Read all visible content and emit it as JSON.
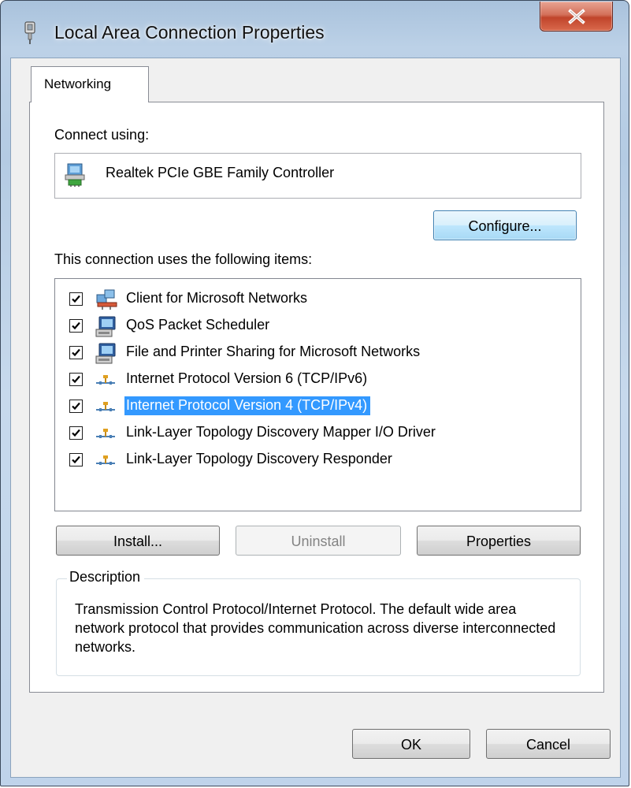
{
  "window": {
    "title": "Local Area Connection Properties",
    "close_label": "X"
  },
  "tabs": [
    {
      "label": "Networking",
      "selected": true
    }
  ],
  "connect_using": {
    "label": "Connect using:",
    "adapter": "Realtek PCIe GBE Family Controller",
    "configure_button": "Configure..."
  },
  "items_section": {
    "label": "This connection uses the following items:",
    "items": [
      {
        "label": "Client for Microsoft Networks",
        "checked": true,
        "icon": "client-network-icon",
        "selected": false
      },
      {
        "label": "QoS Packet Scheduler",
        "checked": true,
        "icon": "service-icon",
        "selected": false
      },
      {
        "label": "File and Printer Sharing for Microsoft Networks",
        "checked": true,
        "icon": "service-icon",
        "selected": false
      },
      {
        "label": "Internet Protocol Version 6 (TCP/IPv6)",
        "checked": true,
        "icon": "protocol-icon",
        "selected": false
      },
      {
        "label": "Internet Protocol Version 4 (TCP/IPv4)",
        "checked": true,
        "icon": "protocol-icon",
        "selected": true
      },
      {
        "label": "Link-Layer Topology Discovery Mapper I/O Driver",
        "checked": true,
        "icon": "protocol-icon",
        "selected": false
      },
      {
        "label": "Link-Layer Topology Discovery Responder",
        "checked": true,
        "icon": "protocol-icon",
        "selected": false
      }
    ]
  },
  "actions": {
    "install": "Install...",
    "uninstall": "Uninstall",
    "properties": "Properties"
  },
  "description": {
    "legend": "Description",
    "text": "Transmission Control Protocol/Internet Protocol. The default wide area network protocol that provides communication across diverse interconnected networks."
  },
  "footer": {
    "ok": "OK",
    "cancel": "Cancel"
  },
  "colors": {
    "selection": "#3399ff",
    "close_button": "#c7462e"
  }
}
